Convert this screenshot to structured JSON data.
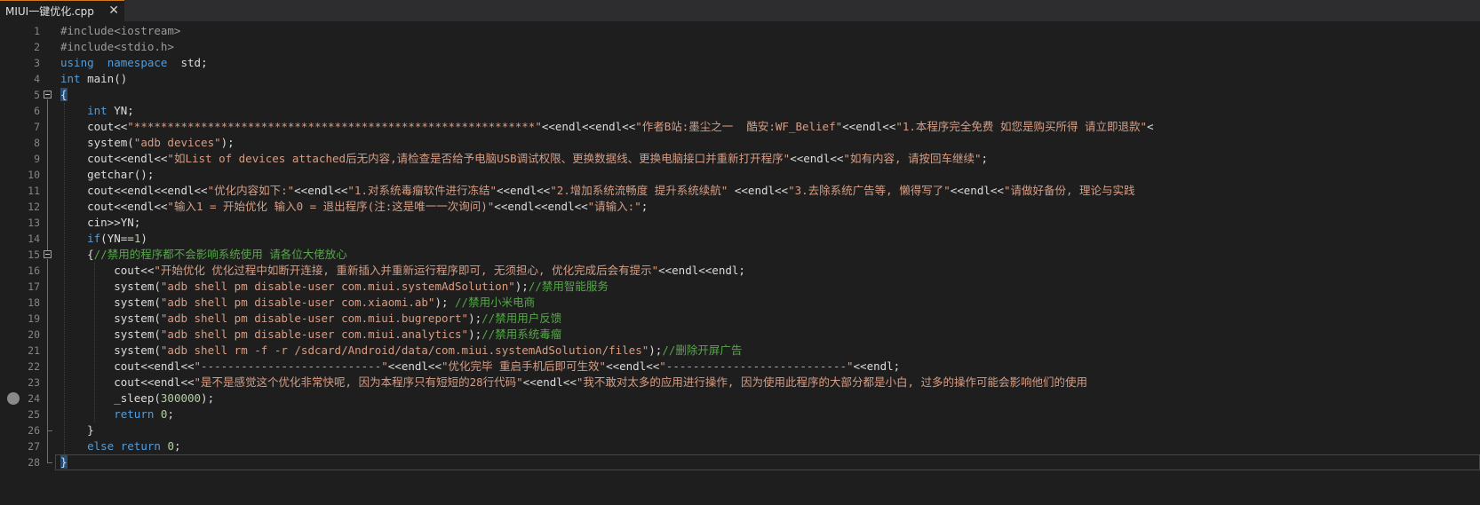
{
  "tab": {
    "title": "MIUI一键优化.cpp",
    "close": "✕"
  },
  "lines": [
    {
      "n": "1",
      "t": [
        [
          "pp",
          "#include<iostream>"
        ]
      ]
    },
    {
      "n": "2",
      "t": [
        [
          "pp",
          "#include<stdio.h>"
        ]
      ]
    },
    {
      "n": "3",
      "t": [
        [
          "kw",
          "using"
        ],
        [
          "",
          "",
          ""
        ],
        [
          "",
          "  "
        ],
        [
          "kw",
          "namespace"
        ],
        [
          "",
          "  std;"
        ]
      ]
    },
    {
      "n": "4",
      "t": [
        [
          "kw",
          "int"
        ],
        [
          "",
          " main()"
        ]
      ]
    },
    {
      "n": "5",
      "t": [
        [
          "",
          "{"
        ]
      ],
      "fold": true
    },
    {
      "n": "6",
      "t": [
        [
          "",
          "    "
        ],
        [
          "kw",
          "int"
        ],
        [
          "",
          " YN;"
        ]
      ]
    },
    {
      "n": "7",
      "t": [
        [
          "",
          "    cout<<"
        ],
        [
          "str",
          "\"************************************************************\""
        ],
        [
          "",
          "<<endl<<endl<<"
        ],
        [
          "str",
          "\"作者B站:墨尘之一  酷安:WF_Belief\""
        ],
        [
          "",
          "<<endl<<"
        ],
        [
          "str",
          "\"1.本程序完全免费 如您是购买所得 请立即退款\""
        ],
        [
          "",
          "<"
        ]
      ]
    },
    {
      "n": "8",
      "t": [
        [
          "",
          "    system("
        ],
        [
          "str",
          "\"adb devices\""
        ],
        [
          "",
          ");"
        ]
      ]
    },
    {
      "n": "9",
      "t": [
        [
          "",
          "    cout<<endl<<"
        ],
        [
          "str",
          "\"如List of devices attached后无内容,请检查是否给予电脑USB调试权限、更换数据线、更换电脑接口并重新打开程序\""
        ],
        [
          "",
          "<<endl<<"
        ],
        [
          "str",
          "\"如有内容, 请按回车继续\""
        ],
        [
          "",
          ";"
        ]
      ]
    },
    {
      "n": "10",
      "t": [
        [
          "",
          "    getchar();"
        ]
      ]
    },
    {
      "n": "11",
      "t": [
        [
          "",
          "    cout<<endl<<endl<<"
        ],
        [
          "str",
          "\"优化内容如下:\""
        ],
        [
          "",
          "<<endl<<"
        ],
        [
          "str",
          "\"1.对系统毒瘤软件进行冻结\""
        ],
        [
          "",
          "<<endl<<"
        ],
        [
          "str",
          "\"2.增加系统流畅度 提升系统续航\""
        ],
        [
          "",
          " <<endl<<"
        ],
        [
          "str",
          "\"3.去除系统广告等, 懒得写了\""
        ],
        [
          "",
          "<<endl<<"
        ],
        [
          "str",
          "\"请做好备份, 理论与实践"
        ]
      ]
    },
    {
      "n": "12",
      "t": [
        [
          "",
          "    cout<<endl<<"
        ],
        [
          "str",
          "\"输入1 = 开始优化 输入0 = 退出程序(注:这是唯一一次询问)\""
        ],
        [
          "",
          "<<endl<<endl<<"
        ],
        [
          "str",
          "\"请输入:\""
        ],
        [
          "",
          ";"
        ]
      ]
    },
    {
      "n": "13",
      "t": [
        [
          "",
          "    cin>>YN;"
        ]
      ]
    },
    {
      "n": "14",
      "t": [
        [
          "",
          "    "
        ],
        [
          "kw",
          "if"
        ],
        [
          "",
          "(YN=="
        ],
        [
          "num",
          "1"
        ],
        [
          "",
          ")"
        ]
      ]
    },
    {
      "n": "15",
      "t": [
        [
          "",
          "    {"
        ],
        [
          "cm",
          "//禁用的程序都不会影响系统使用 请各位大佬放心"
        ]
      ],
      "fold": true
    },
    {
      "n": "16",
      "t": [
        [
          "",
          "        cout<<"
        ],
        [
          "str",
          "\"开始优化 优化过程中如断开连接, 重新插入并重新运行程序即可, 无须担心, 优化完成后会有提示\""
        ],
        [
          "",
          "<<endl<<endl;"
        ]
      ]
    },
    {
      "n": "17",
      "t": [
        [
          "",
          "        system("
        ],
        [
          "str",
          "\"adb shell pm disable-user com.miui.systemAdSolution\""
        ],
        [
          "",
          ");"
        ],
        [
          "cm",
          "//禁用智能服务"
        ]
      ]
    },
    {
      "n": "18",
      "t": [
        [
          "",
          "        system("
        ],
        [
          "str",
          "\"adb shell pm disable-user com.xiaomi.ab\""
        ],
        [
          "",
          "); "
        ],
        [
          "cm",
          "//禁用小米电商"
        ]
      ]
    },
    {
      "n": "19",
      "t": [
        [
          "",
          "        system("
        ],
        [
          "str",
          "\"adb shell pm disable-user com.miui.bugreport\""
        ],
        [
          "",
          ");"
        ],
        [
          "cm",
          "//禁用用户反馈"
        ]
      ]
    },
    {
      "n": "20",
      "t": [
        [
          "",
          "        system("
        ],
        [
          "str",
          "\"adb shell pm disable-user com.miui.analytics\""
        ],
        [
          "",
          ");"
        ],
        [
          "cm",
          "//禁用系统毒瘤"
        ]
      ]
    },
    {
      "n": "21",
      "t": [
        [
          "",
          "        system("
        ],
        [
          "str",
          "\"adb shell rm -f -r /sdcard/Android/data/com.miui.systemAdSolution/files\""
        ],
        [
          "",
          ");"
        ],
        [
          "cm",
          "//删除开屏广告"
        ]
      ]
    },
    {
      "n": "22",
      "t": [
        [
          "",
          "        cout<<endl<<"
        ],
        [
          "str",
          "\"---------------------------\""
        ],
        [
          "",
          "<<endl<<"
        ],
        [
          "str",
          "\"优化完毕 重启手机后即可生效\""
        ],
        [
          "",
          "<<endl<<"
        ],
        [
          "str",
          "\"---------------------------\""
        ],
        [
          "",
          "<<endl;"
        ]
      ]
    },
    {
      "n": "23",
      "t": [
        [
          "",
          "        cout<<endl<<"
        ],
        [
          "str",
          "\"是不是感觉这个优化非常快呢, 因为本程序只有短短的28行代码\""
        ],
        [
          "",
          "<<endl<<"
        ],
        [
          "str",
          "\"我不敢对太多的应用进行操作, 因为使用此程序的大部分都是小白, 过多的操作可能会影响他们的使用"
        ]
      ]
    },
    {
      "n": "24",
      "t": [
        [
          "",
          "        _sleep("
        ],
        [
          "num",
          "300000"
        ],
        [
          "",
          ");"
        ]
      ],
      "bp": true
    },
    {
      "n": "25",
      "t": [
        [
          "",
          "        "
        ],
        [
          "kw",
          "return"
        ],
        [
          "",
          " "
        ],
        [
          "num",
          "0"
        ],
        [
          "",
          ";"
        ]
      ]
    },
    {
      "n": "26",
      "t": [
        [
          "",
          "    }"
        ]
      ]
    },
    {
      "n": "27",
      "t": [
        [
          "",
          "    "
        ],
        [
          "kw",
          "else"
        ],
        [
          "",
          " "
        ],
        [
          "kw",
          "return"
        ],
        [
          "",
          " "
        ],
        [
          "num",
          "0"
        ],
        [
          "",
          ";"
        ]
      ]
    },
    {
      "n": "28",
      "t": [
        [
          "",
          "}"
        ]
      ],
      "current": true
    }
  ]
}
